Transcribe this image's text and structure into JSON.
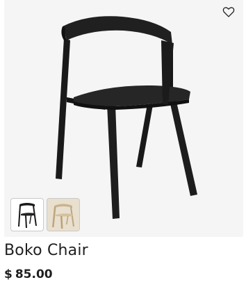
{
  "product": {
    "name": "Boko Chair",
    "currency_symbol": "$",
    "price": "85.00"
  },
  "gallery": {
    "thumbnails": [
      {
        "icon": "chair-black-thumbnail"
      },
      {
        "icon": "chair-wood-thumbnail"
      }
    ]
  },
  "colors": {
    "panel_bg": "#f5f5f5",
    "chair_black": "#1c1c1c",
    "wood": "#d8c8aa"
  }
}
